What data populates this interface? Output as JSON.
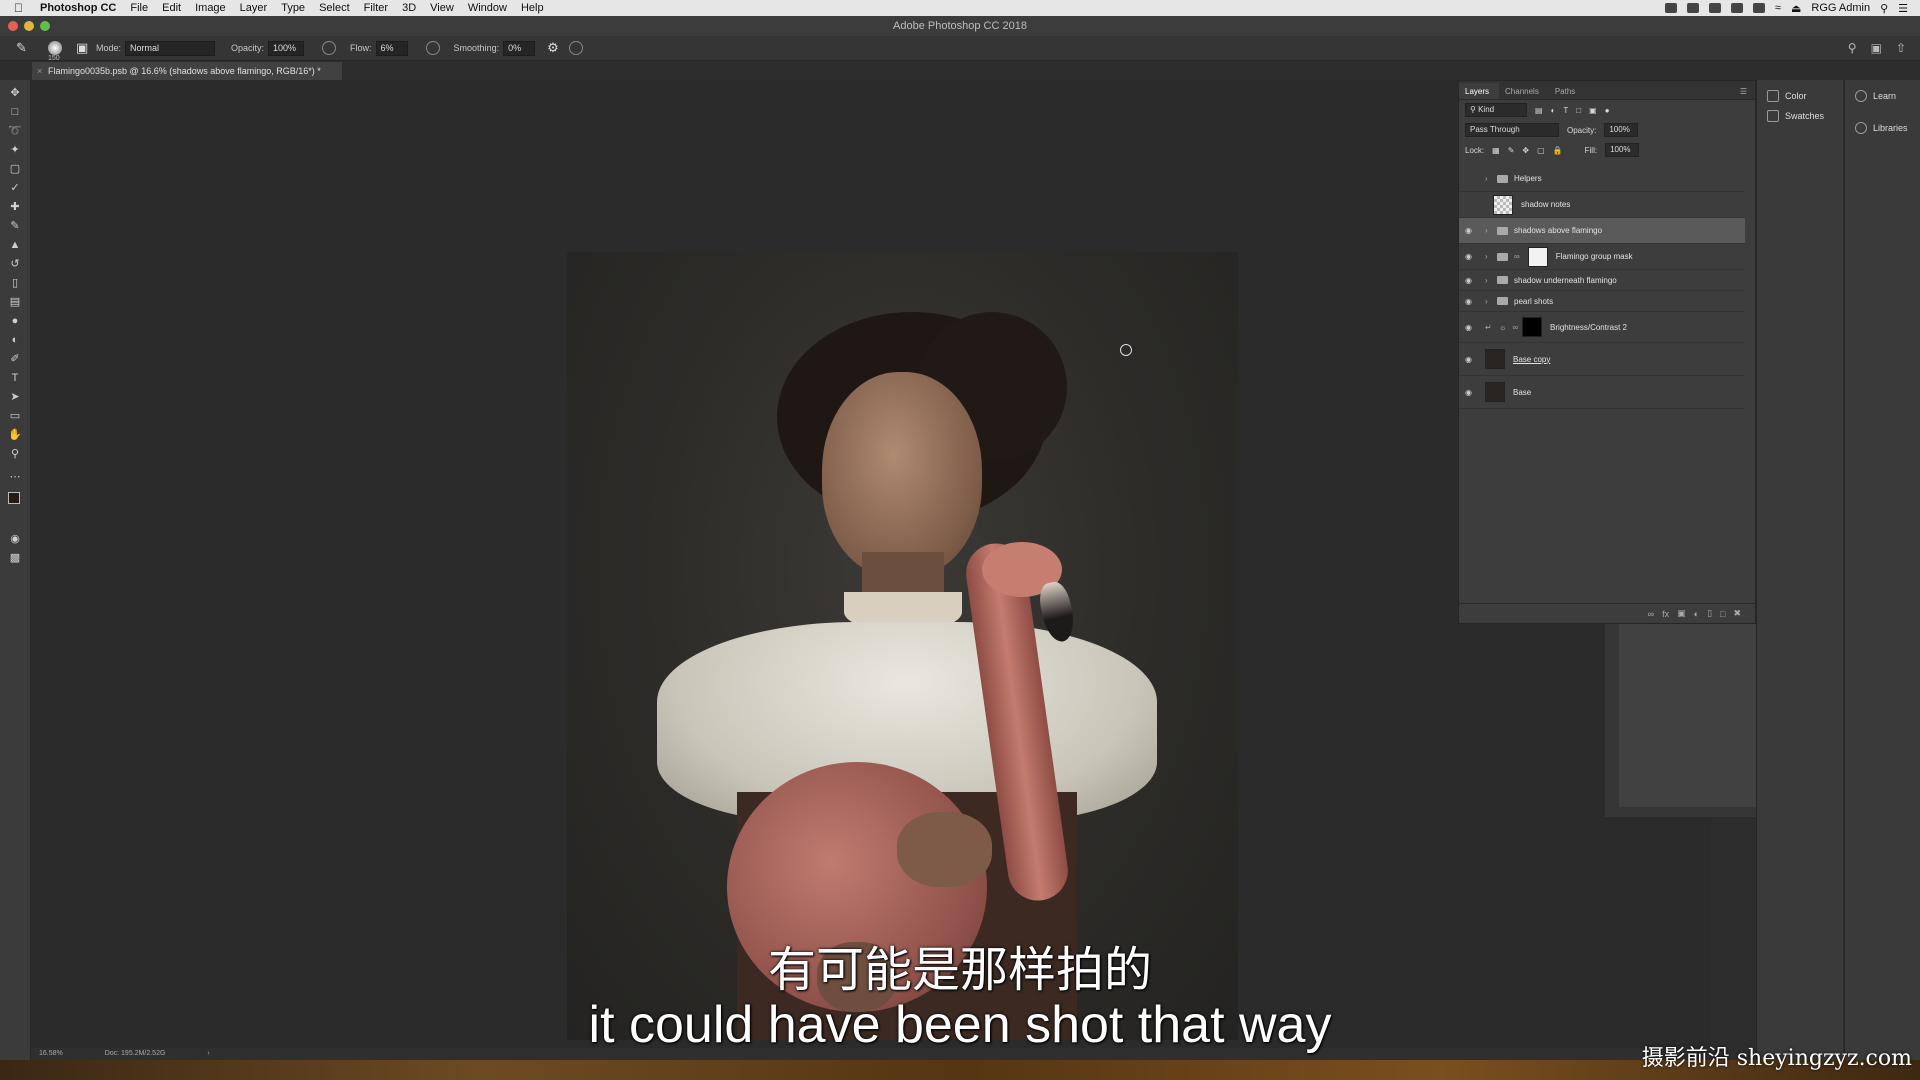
{
  "menubar": {
    "app": "Photoshop CC",
    "items": [
      "File",
      "Edit",
      "Image",
      "Layer",
      "Type",
      "Select",
      "Filter",
      "3D",
      "View",
      "Window",
      "Help"
    ],
    "user": "RGG Admin"
  },
  "window": {
    "title": "Adobe Photoshop CC 2018"
  },
  "options": {
    "brush_size": "150",
    "mode_label": "Mode:",
    "mode_value": "Normal",
    "opacity_label": "Opacity:",
    "opacity_value": "100%",
    "flow_label": "Flow:",
    "flow_value": "6%",
    "smoothing_label": "Smoothing:",
    "smoothing_value": "0%"
  },
  "document": {
    "tab_title": "Flamingo0035b.psb @ 16.6% (shadows above flamingo, RGB/16*) *"
  },
  "status": {
    "zoom": "16.58%",
    "doc": "Doc: 195.2M/2.52G"
  },
  "layers_panel": {
    "tabs": [
      "Layers",
      "Channels",
      "Paths"
    ],
    "filter": "Kind",
    "blend_mode": "Pass Through",
    "opacity_label": "Opacity:",
    "opacity_value": "100%",
    "lock_label": "Lock:",
    "fill_label": "Fill:",
    "fill_value": "100%",
    "layers": [
      {
        "name": "Helpers"
      },
      {
        "name": "shadow notes"
      },
      {
        "name": "shadows above flamingo"
      },
      {
        "name": "Flamingo group  mask"
      },
      {
        "name": "shadow underneath flamingo"
      },
      {
        "name": "pearl shots"
      },
      {
        "name": "Brightness/Contrast 2"
      },
      {
        "name": "Base copy"
      },
      {
        "name": "Base"
      }
    ]
  },
  "side_panels": {
    "color": "Color",
    "swatches": "Swatches",
    "learn": "Learn",
    "libraries": "Libraries"
  },
  "subtitles": {
    "chinese": "有可能是那样拍的",
    "english": "it could have been shot that way"
  },
  "watermark": "摄影前沿 sheyingzyz.com"
}
